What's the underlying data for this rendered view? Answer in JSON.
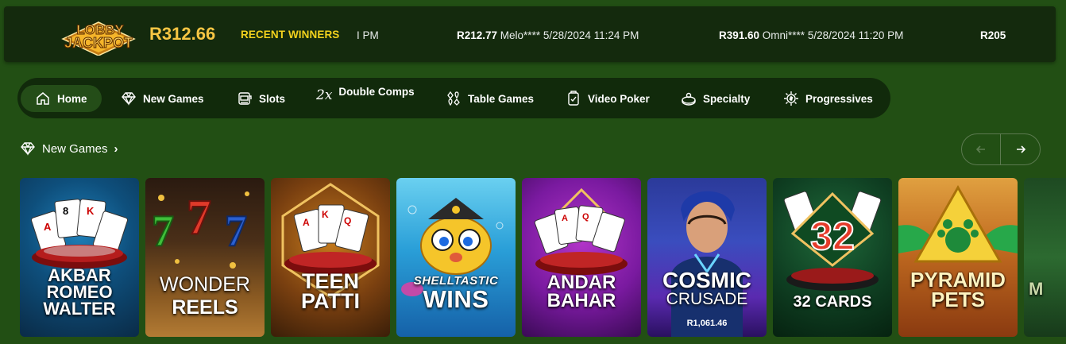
{
  "header": {
    "logo_text": [
      "LOBBY",
      "JACKPOT"
    ],
    "jackpot_amount": "R312.66",
    "recent_winners_label": "RECENT WINNERS",
    "ticker": [
      {
        "amount": "",
        "tail": "I PM"
      },
      {
        "amount": "R212.77",
        "tail": " Melo**** 5/28/2024 11:24 PM"
      },
      {
        "amount": "R391.60",
        "tail": " Omni**** 5/28/2024 11:20 PM"
      },
      {
        "amount": "R205",
        "tail": ""
      }
    ]
  },
  "nav": {
    "items": [
      {
        "label": "Home",
        "icon": "home-icon",
        "active": true
      },
      {
        "label": "New Games",
        "icon": "diamond-icon"
      },
      {
        "label": "Slots",
        "icon": "slot-machine-icon"
      },
      {
        "label": "Double Comps",
        "icon": "double-comps-icon",
        "glyph": "2x"
      },
      {
        "label": "Table Games",
        "icon": "card-suits-icon"
      },
      {
        "label": "Video Poker",
        "icon": "video-poker-icon"
      },
      {
        "label": "Specialty",
        "icon": "specialty-icon"
      },
      {
        "label": "Progressives",
        "icon": "progressives-icon"
      }
    ]
  },
  "section": {
    "title": "New Games",
    "icon": "diamond-icon"
  },
  "games": [
    {
      "title": [
        "AKBAR",
        "ROMEO",
        "WALTER"
      ],
      "jackpot": ""
    },
    {
      "title": [
        "WONDER",
        "REELS"
      ],
      "jackpot": ""
    },
    {
      "title": [
        "TEEN",
        "PATTI"
      ],
      "jackpot": ""
    },
    {
      "title": [
        "SHELLTASTIC",
        "WINS"
      ],
      "jackpot": ""
    },
    {
      "title": [
        "ANDAR",
        "BAHAR"
      ],
      "jackpot": ""
    },
    {
      "title": [
        "COSMIC",
        "CRUSADE"
      ],
      "jackpot": "R1,061.46"
    },
    {
      "title": [
        "32 CARDS"
      ],
      "jackpot": ""
    },
    {
      "title": [
        "PYRAMID",
        "PETS"
      ],
      "jackpot": ""
    },
    {
      "title": [
        "M"
      ],
      "jackpot": ""
    }
  ],
  "colors": {
    "page_bg": "#224f14",
    "bar_bg": "#142a0d",
    "gold": "#f6c543",
    "winners_yellow": "#f2d11d"
  }
}
